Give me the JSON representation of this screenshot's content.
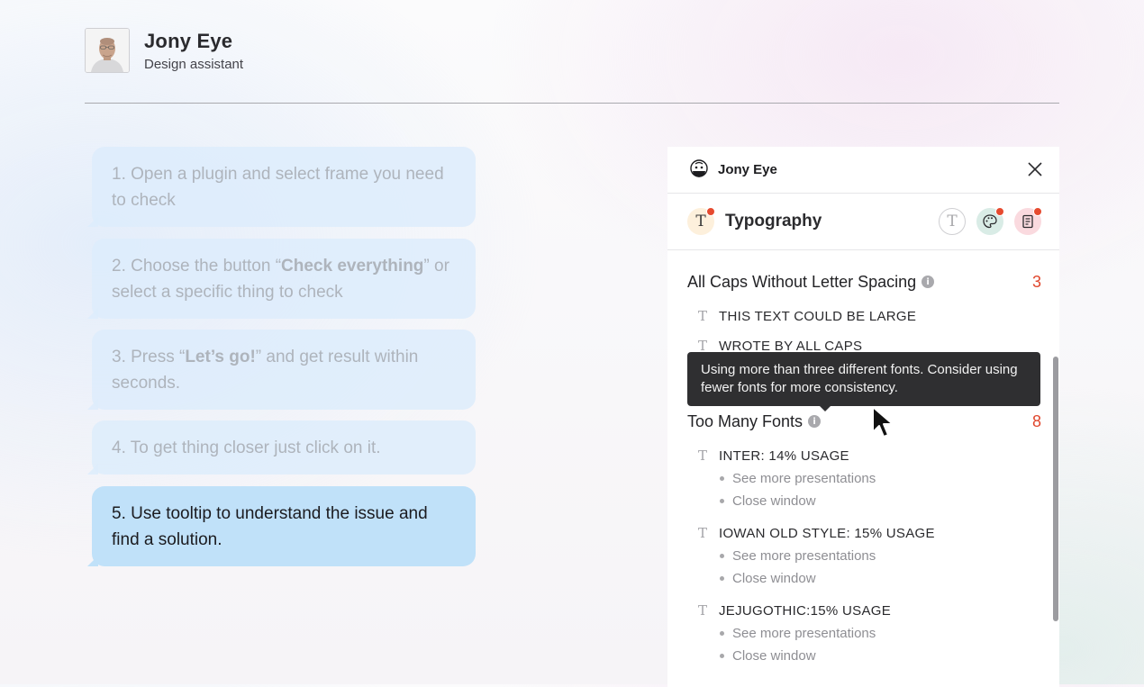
{
  "header": {
    "name": "Jony Eye",
    "role": "Design assistant"
  },
  "steps": [
    {
      "pre": "1. Open a plugin and select frame you need to check",
      "bold": "",
      "post": ""
    },
    {
      "pre": "2. Choose the button “",
      "bold": "Check everything",
      "post": "” or select a specific thing to check"
    },
    {
      "pre": "3. Press “",
      "bold": "Let’s go!",
      "post": "” and get result within seconds."
    },
    {
      "pre": "4. To get thing closer just click on it.",
      "bold": "",
      "post": ""
    },
    {
      "pre": "5. Use tooltip to understand the issue and find a solution.",
      "bold": "",
      "post": ""
    }
  ],
  "panel": {
    "title": "Jony Eye",
    "tab_label": "Typography",
    "tab_glyph": "T",
    "icons": {
      "logo": "face-logo-icon",
      "close": "close-icon",
      "typography": "typography-icon",
      "palette": "palette-icon",
      "document": "document-icon",
      "info": "info-icon",
      "cursor": "cursor-icon"
    },
    "info_glyph": "i",
    "sections": [
      {
        "title": "All Caps Without Letter Spacing",
        "count": "3",
        "items": [
          {
            "label": "THIS TEXT COULD BE LARGE"
          },
          {
            "label": "WROTE BY ALL CAPS"
          }
        ]
      },
      {
        "title": "Too Many Fonts",
        "count": "8",
        "items": [
          {
            "label": "INTER: 14% USAGE",
            "subs": [
              "See more presentations",
              "Close window"
            ]
          },
          {
            "label": "IOWAN OLD STYLE: 15% USAGE",
            "subs": [
              "See more presentations",
              "Close window"
            ]
          },
          {
            "label": "JEJUGOTHIC:15% USAGE",
            "subs": [
              "See more presentations",
              "Close window"
            ]
          }
        ]
      }
    ],
    "tooltip": "Using more than three different fonts. Consider using fewer fonts for more consistency."
  },
  "colors": {
    "active_bubble": "#c0e1f9",
    "inactive_bubble": "#ddecfc",
    "count_red": "#e0462c",
    "notification_dot": "#e64a2f",
    "tooltip_bg": "#2f2f31"
  }
}
